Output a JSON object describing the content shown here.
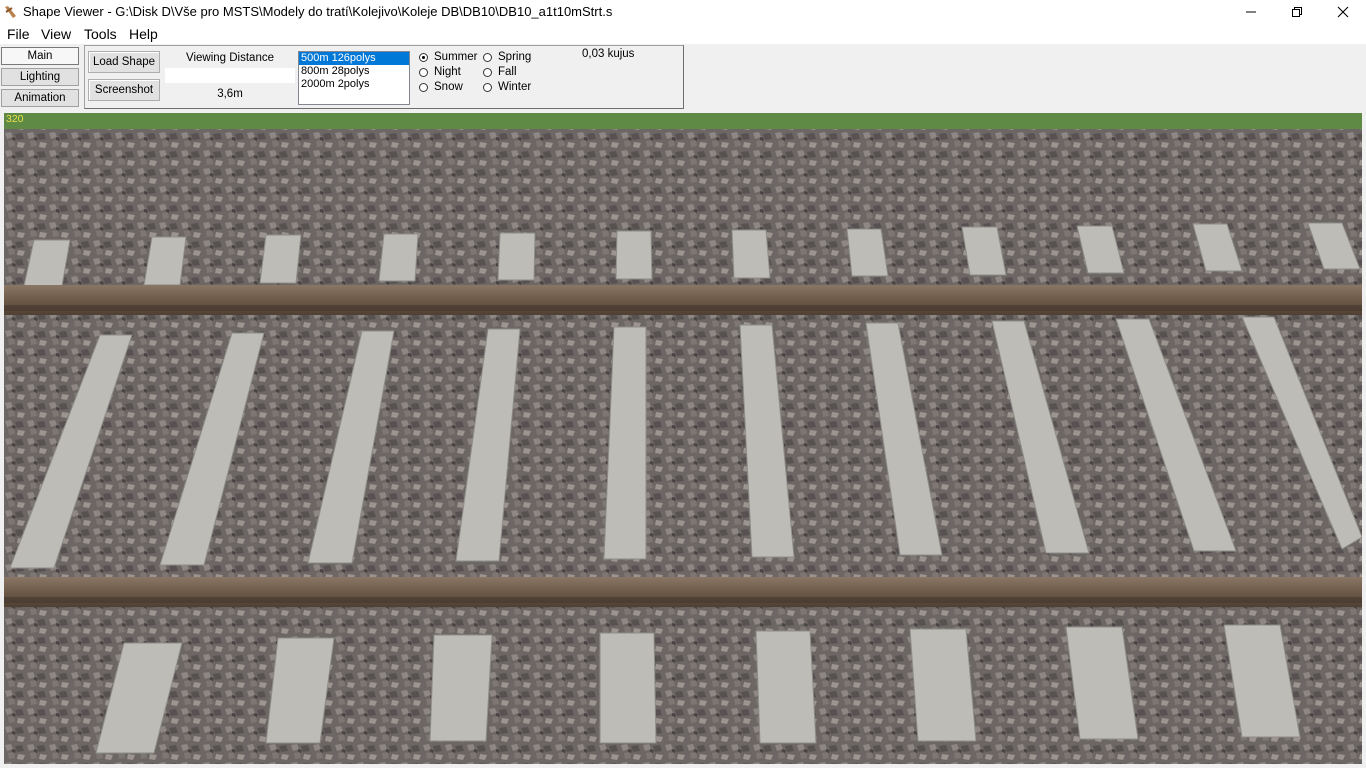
{
  "window": {
    "title": "Shape Viewer - G:\\Disk D\\Vše pro MSTS\\Modely do tratí\\Kolejivo\\Koleje DB\\DB10\\DB10_a1t10mStrt.s",
    "icon": "app-icon"
  },
  "menu": [
    "File",
    "View",
    "Tools",
    "Help"
  ],
  "tabs": [
    {
      "label": "Main",
      "active": true
    },
    {
      "label": "Lighting",
      "active": false
    },
    {
      "label": "Animation",
      "active": false
    }
  ],
  "panel": {
    "load_shape": "Load Shape",
    "screenshot": "Screenshot",
    "viewing_distance_label": "Viewing Distance",
    "viewing_distance_value": "3,6m",
    "lods": [
      {
        "label": "500m 126polys",
        "selected": true
      },
      {
        "label": "800m 28polys",
        "selected": false
      },
      {
        "label": "2000m 2polys",
        "selected": false
      }
    ],
    "seasons": {
      "summer": "Summer",
      "spring": "Spring",
      "night": "Night",
      "fall": "Fall",
      "snow": "Snow",
      "winter": "Winter",
      "selected": "Summer"
    },
    "fps": "0,03 kujus"
  },
  "viewport": {
    "frame_count": "320",
    "colors": {
      "ballast": "#6f6a68",
      "grass": "#5f8a45",
      "sleeper": "#bdbcb7",
      "rail": "#6e5a48"
    }
  }
}
